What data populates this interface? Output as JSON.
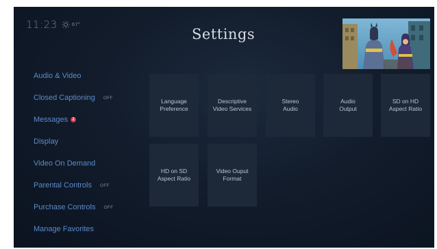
{
  "status": {
    "time": "11:23",
    "weather_icon": "sun-icon",
    "temperature": "67°"
  },
  "header": {
    "title": "Settings"
  },
  "menu": {
    "items": [
      {
        "label": "Audio & Video",
        "badge": ""
      },
      {
        "label": "Closed Captioning",
        "badge": "OFF"
      },
      {
        "label": "Messages",
        "badge": "",
        "notification_count": "2"
      },
      {
        "label": "Display",
        "badge": ""
      },
      {
        "label": "Video On Demand",
        "badge": ""
      },
      {
        "label": "Parental Controls",
        "badge": "OFF"
      },
      {
        "label": "Purchase Controls",
        "badge": "OFF"
      },
      {
        "label": "Manage Favorites",
        "badge": ""
      }
    ]
  },
  "tiles": [
    {
      "label": "Language\nPreference"
    },
    {
      "label": "Descriptive\nVideo Services"
    },
    {
      "label": "Stereo\nAudio"
    },
    {
      "label": "Audio\nOutput"
    },
    {
      "label": "SD on HD\nAspect Ratio"
    },
    {
      "label": "HD on SD\nAspect Ratio"
    },
    {
      "label": "Video Ouput\nFormat"
    }
  ],
  "colors": {
    "menu_text": "#5a8ccc",
    "tile_bg": "#1d2838",
    "badge": "#d6344a"
  }
}
